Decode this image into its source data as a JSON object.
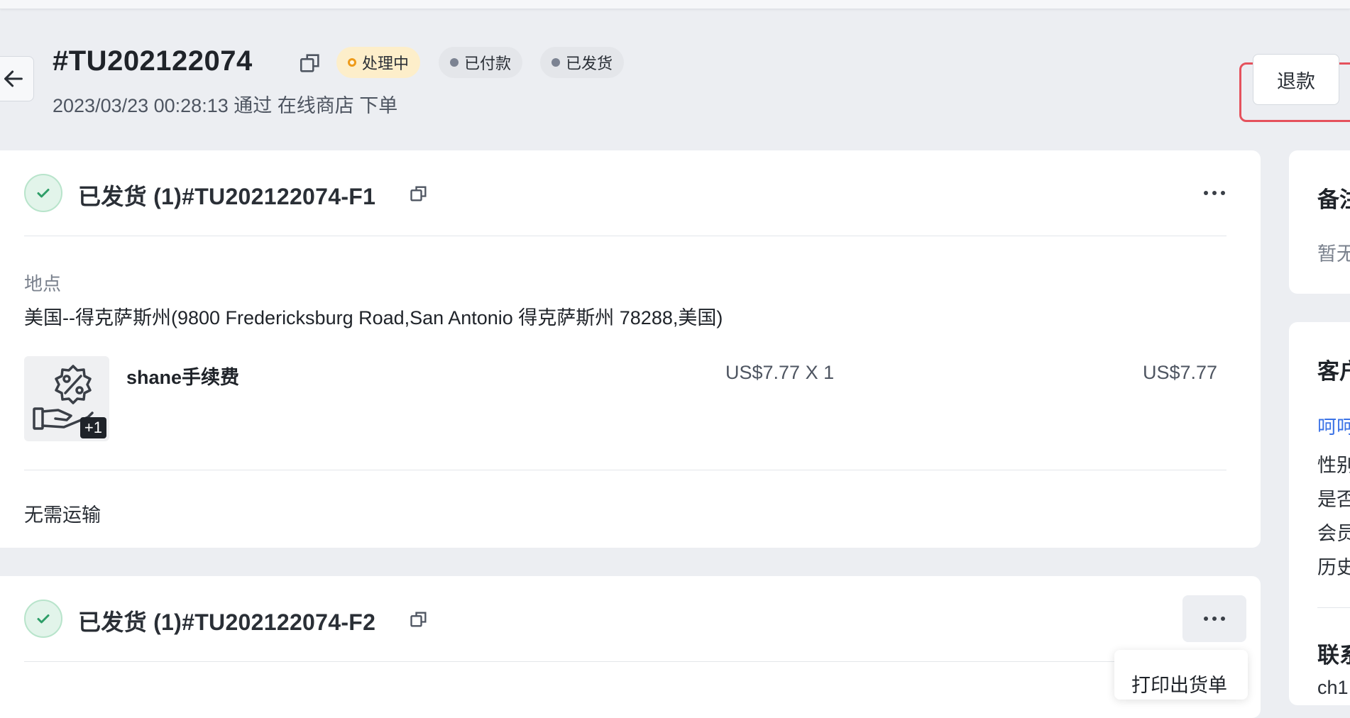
{
  "header": {
    "order_id": "#TU202122074",
    "status_badges": [
      {
        "label": "处理中",
        "color": "#ee9b1b"
      },
      {
        "label": "已付款",
        "color": "#7c8392"
      },
      {
        "label": "已发货",
        "color": "#7c8392"
      }
    ],
    "order_meta": "2023/03/23 00:28:13 通过 在线商店 下单",
    "refund_label": "退款",
    "highlight_color": "#e5525d"
  },
  "fulfillments": [
    {
      "title": "已发货 (1)#TU202122074-F1",
      "location_label": "地点",
      "location_value": "美国--得克萨斯州(9800 Fredericksburg Road,San Antonio 得克萨斯州 78288,美国)",
      "product": {
        "name": "shane手续费",
        "image_badge": "+1",
        "price_qty": "US$7.77 X 1",
        "total": "US$7.77",
        "icon": "discount-hand-icon"
      },
      "shipping_note": "无需运输"
    },
    {
      "title": "已发货 (1)#TU202122074-F2",
      "menu_items": [
        "打印出货单"
      ]
    }
  ],
  "sidebar": {
    "notes_heading": "备注",
    "notes_empty": "暂无",
    "customer_heading": "客户",
    "customer_link": "呵呵",
    "customer_fields": [
      "性别",
      "是否",
      "会员",
      "历史"
    ],
    "contact_heading": "联系",
    "contact_value": "ch1"
  },
  "colors": {
    "success": "#2e9e68",
    "link": "#3b73e6",
    "background": "#eceef2"
  }
}
